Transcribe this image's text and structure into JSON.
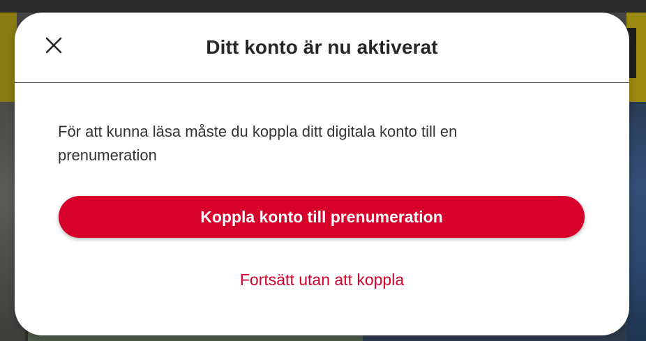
{
  "modal": {
    "title": "Ditt konto är nu aktiverat",
    "close_icon": "close-icon",
    "body_text": "För att kunna läsa måste du koppla ditt digitala konto till en prenumeration",
    "primary_button_label": "Koppla konto till prenumeration",
    "secondary_link_label": "Fortsätt utan att koppla"
  },
  "colors": {
    "accent": "#d7002a",
    "title_text": "#262626",
    "body_text": "#333333",
    "backdrop": "#454545"
  }
}
